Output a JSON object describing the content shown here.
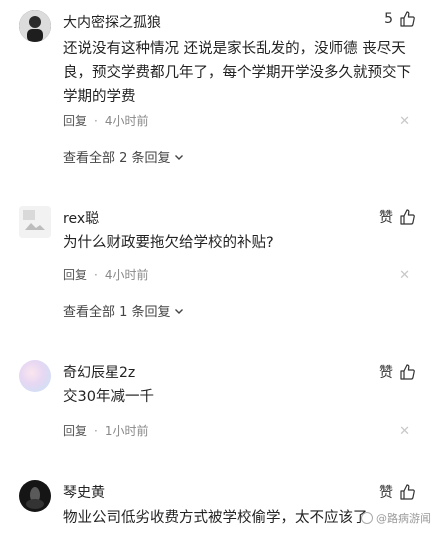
{
  "comments": [
    {
      "username": "大内密探之孤狼",
      "like_label": "5",
      "content": "还说没有这种情况 还说是家长乱发的，没师德 丧尽天良，预交学费都几年了，每个学期开学没多久就预交下学期的学费",
      "reply_label": "回复",
      "time": "4小时前",
      "expand_label": "查看全部 2 条回复"
    },
    {
      "username": "rex聪",
      "like_label": "赞",
      "content": "为什么财政要拖欠给学校的补贴?",
      "reply_label": "回复",
      "time": "4小时前",
      "expand_label": "查看全部 1 条回复"
    },
    {
      "username": "奇幻辰星2z",
      "like_label": "赞",
      "content": "交30年减一千",
      "reply_label": "回复",
      "time": "1小时前"
    },
    {
      "username": "琴史黄",
      "like_label": "赞",
      "content": "物业公司低劣收费方式被学校偷学，太不应该了"
    }
  ],
  "watermark": "@路病游闻",
  "icons": {
    "like": "thumbs-up-icon",
    "close": "close-icon",
    "chevron": "chevron-down-icon"
  }
}
